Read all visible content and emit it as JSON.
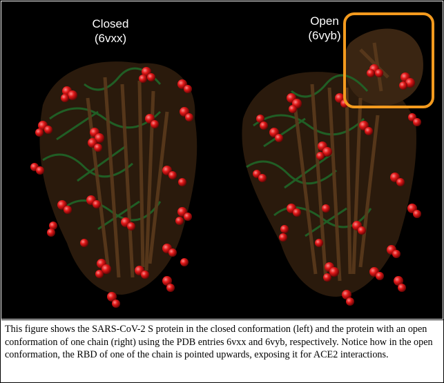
{
  "labels": {
    "closed_title": "Closed",
    "closed_pdb": "(6vxx)",
    "open_title": "Open",
    "open_pdb": "(6vyb)"
  },
  "highlight": {
    "color": "#f39a1e",
    "target": "RBD of one chain (open conformation)"
  },
  "colors": {
    "background": "#000000",
    "glycan_spheres": "#e01818",
    "chain_green": "#1f6b2a",
    "chain_brown": "#5a3a1c"
  },
  "caption": "This figure shows the SARS-CoV-2 S protein in the closed conformation (left) and the protein with an open conformation of one chain (right) using the PDB entries 6vxx and 6vyb, respectively. Notice how in the open conformation, the RBD of one of the chain is pointed upwards, exposing it for ACE2 interactions."
}
